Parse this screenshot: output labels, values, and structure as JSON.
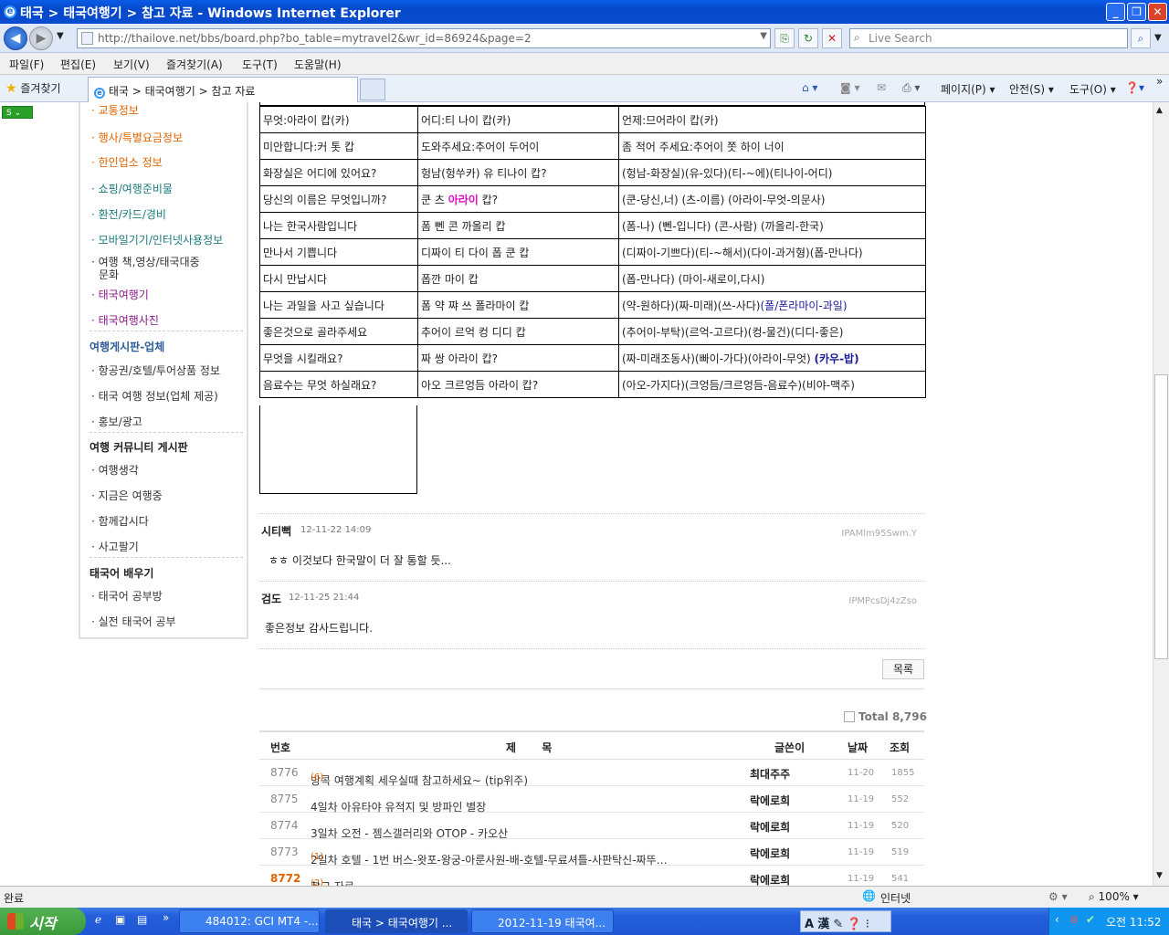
{
  "window": {
    "title": "태국 > 태국여행기 > 참고 자료 - Windows Internet Explorer"
  },
  "address": {
    "url": "http://thailove.net/bbs/board.php?bo_table=mytravel2&wr_id=86924&page=2",
    "search_placeholder": "Live Search"
  },
  "menu": [
    "파일(F)",
    "편집(E)",
    "보기(V)",
    "즐겨찾기(A)",
    "도구(T)",
    "도움말(H)"
  ],
  "favbar": {
    "favorites": "즐겨찾기",
    "tab": "태국 > 태국여행기 > 참고 자료"
  },
  "commands": {
    "page": "페이지(P)",
    "safety": "안전(S)",
    "tools": "도구(O)"
  },
  "sidebar": {
    "items_top": [
      "교통정보",
      "행사/특별요금정보",
      "한인업소 정보",
      "쇼핑/여행준비물",
      "환전/카드/경비",
      "모바일기기/인터넷사용정보",
      "여행 책,영상/태국대중",
      "문화",
      "태국여행기",
      "태국여행사진"
    ],
    "head_business": "여행게시판-업체",
    "business": [
      "항공권/호텔/투어상품 정보",
      "태국 여행 정보(업체 제공)",
      "홍보/광고"
    ],
    "head_community": "여행 커뮤니티 게시판",
    "community": [
      "여행생각",
      "지금은 여행중",
      "함께갑시다",
      "사고팔기"
    ],
    "head_learn": "태국어 배우기",
    "learn": [
      "태국어 공부방",
      "실전 태국어 공부"
    ]
  },
  "phrases": [
    [
      "무엇:아라이 캅(카)",
      "어디:티 나이 캅(카)",
      "언제:므어라이 캅(카)"
    ],
    [
      "미안합니다:커 톳 캅",
      "도와주세요:추어이 두어이",
      "좀 적어 주세요:추어이 쫏 하이 너이"
    ],
    [
      "화장실은 어디에 있어요?",
      "헝남(헝쑤카) 유 티나이 캅?",
      "(헝남-화장실)(유-있다)(티-~에)(티나이-어디)"
    ],
    [
      "당신의 이름은 무엇입니까?",
      "쿤 츠 ",
      "아라이",
      " 캅?",
      "(쿤-당신,너) (츠-이름) (아라이-무엇-의문사)"
    ],
    [
      "나는 한국사람입니다",
      "폼 뻰 콘 까올리 캅",
      "(폼-나) (뻰-입니다) (콘-사람) (까올리-한국)"
    ],
    [
      "만나서 기쁩니다",
      "디짜이 티 다이 폽 쿤 캅",
      "(디짜이-기쁘다)(티-~해서)(다이-과거형)(폽-만나다)"
    ],
    [
      "다시 만납시다",
      "폽깐 마이 캅",
      "(폽-만나다) (마이-새로이,다시)"
    ],
    [
      "나는 과일을 사고 싶습니다",
      "폼 약 쨔 쓰 폴라마이 캅",
      "(약-원하다)(짜-미래)(쓰-사다)",
      "(폴/폰라마이-과일)"
    ],
    [
      "좋은것으로 골라주세요",
      "추어이 르억 컹 디디 캅",
      "(추어이-부탁)(르억-고르다)(컹-물건)(디디-좋은)"
    ],
    [
      "무엇을 시킬래요?",
      "짜 쌍 아라이 캅?",
      "(짜-미래조동사)(빠이-가다)(아라이-무엇)",
      "(카우-밥)"
    ],
    [
      "음료수는 무엇 하실래요?",
      "아오 크르엉듬 아라이 캅?",
      "(아오-가지다)(크엉듬/크르엉듬-음료수)(비야-맥주)"
    ]
  ],
  "comments": [
    {
      "author": "시티뻑",
      "date": "12-11-22 14:09",
      "ip": "IPAMlm95Swm.Y",
      "text": "ㅎㅎ 이것보다 한국말이 더 잘 통할 듯..."
    },
    {
      "author": "검도",
      "date": "12-11-25 21:44",
      "ip": "IPMPcsDj4zZso",
      "text": "좋은정보 감사드립니다."
    }
  ],
  "list_button": "목록",
  "total": "Total 8,796",
  "board_header": {
    "num": "번호",
    "title": "제 목",
    "writer": "글쓴이",
    "date": "날짜",
    "hits": "조회"
  },
  "board_rows": [
    {
      "num": "8776",
      "title": "방콕 여행계획 세우실때 참고하세요~ (tip위주)",
      "cmt": "(6)",
      "writer": "최대주주",
      "date": "11-20",
      "hits": "1855"
    },
    {
      "num": "8775",
      "title": "4일차 아유타야 유적지 및 방파인 별장",
      "cmt": "",
      "writer": "락에로희",
      "date": "11-19",
      "hits": "552"
    },
    {
      "num": "8774",
      "title": "3일차 오전 - 젬스갤러리와 OTOP - 카오산",
      "cmt": "",
      "writer": "락에로희",
      "date": "11-19",
      "hits": "520"
    },
    {
      "num": "8773",
      "title": "2일차 호텔 - 1번 버스-왓포-왕궁-아룬사원-배-호텔-무료셔틀-사판탁신-짜뚜…",
      "cmt": "(1)",
      "writer": "락에로희",
      "date": "11-19",
      "hits": "519"
    },
    {
      "num": "8772",
      "title": "참고 자료",
      "cmt": "(2)",
      "writer": "락에로희",
      "date": "11-19",
      "hits": "541"
    }
  ],
  "status": {
    "left": "완료",
    "zone": "인터넷",
    "zoom": "100%"
  },
  "taskbar": {
    "start": "시작",
    "tasks": [
      "484012: GCI MT4 -...",
      "태국 > 태국여행기 ...",
      "2012-11-19 태국여..."
    ],
    "clock": "오전 11:52"
  },
  "colors": {
    "accent_magenta": "#e010c0",
    "accent_navy": "#1a1a9a",
    "sidebar_orange": "#e06400"
  }
}
